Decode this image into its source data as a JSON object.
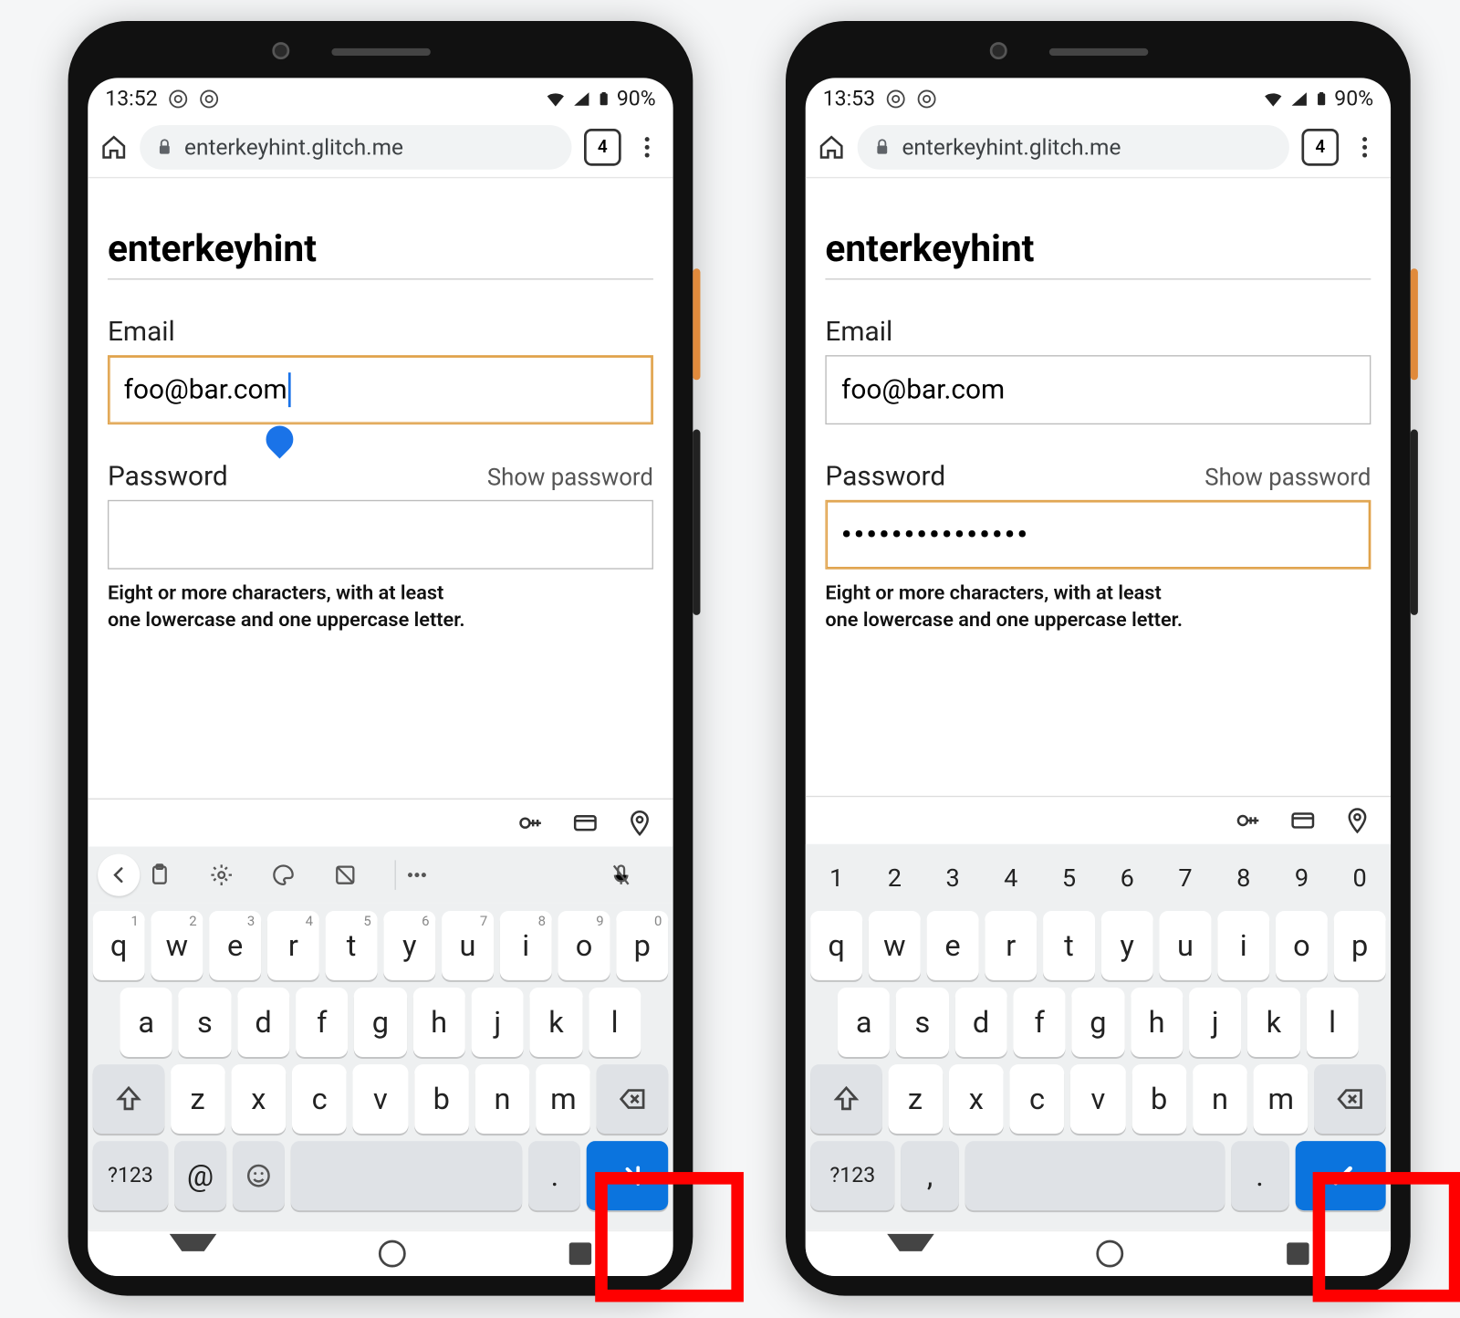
{
  "phones": [
    {
      "status": {
        "time": "13:52",
        "battery": "90%"
      },
      "url": "enterkeyhint.glitch.me",
      "tab_count": "4",
      "page_title": "enterkeyhint",
      "email": {
        "label": "Email",
        "value": "foo@bar.com",
        "focused": true
      },
      "password": {
        "label": "Password",
        "show_label": "Show password",
        "value": "",
        "focused": false
      },
      "hint_line1": "Eight or more characters, with at least",
      "hint_line2": "one lowercase and one uppercase letter.",
      "keyboard": {
        "has_number_row": false,
        "has_toolbar": true,
        "row1": [
          {
            "k": "q",
            "s": "1"
          },
          {
            "k": "w",
            "s": "2"
          },
          {
            "k": "e",
            "s": "3"
          },
          {
            "k": "r",
            "s": "4"
          },
          {
            "k": "t",
            "s": "5"
          },
          {
            "k": "y",
            "s": "6"
          },
          {
            "k": "u",
            "s": "7"
          },
          {
            "k": "i",
            "s": "8"
          },
          {
            "k": "o",
            "s": "9"
          },
          {
            "k": "p",
            "s": "0"
          }
        ],
        "row2": [
          "a",
          "s",
          "d",
          "f",
          "g",
          "h",
          "j",
          "k",
          "l"
        ],
        "row3": [
          "z",
          "x",
          "c",
          "v",
          "b",
          "n",
          "m"
        ],
        "bottom": {
          "sym": "?123",
          "extra": "@",
          "emoji": "☺",
          "dot": ".",
          "enter_type": "next"
        }
      }
    },
    {
      "status": {
        "time": "13:53",
        "battery": "90%"
      },
      "url": "enterkeyhint.glitch.me",
      "tab_count": "4",
      "page_title": "enterkeyhint",
      "email": {
        "label": "Email",
        "value": "foo@bar.com",
        "focused": false
      },
      "password": {
        "label": "Password",
        "show_label": "Show password",
        "value": "•••••••••••••••",
        "focused": true
      },
      "hint_line1": "Eight or more characters, with at least",
      "hint_line2": "one lowercase and one uppercase letter.",
      "keyboard": {
        "has_number_row": true,
        "has_toolbar": false,
        "num_row": [
          "1",
          "2",
          "3",
          "4",
          "5",
          "6",
          "7",
          "8",
          "9",
          "0"
        ],
        "row1": [
          {
            "k": "q"
          },
          {
            "k": "w"
          },
          {
            "k": "e"
          },
          {
            "k": "r"
          },
          {
            "k": "t"
          },
          {
            "k": "y"
          },
          {
            "k": "u"
          },
          {
            "k": "i"
          },
          {
            "k": "o"
          },
          {
            "k": "p"
          }
        ],
        "row2": [
          "a",
          "s",
          "d",
          "f",
          "g",
          "h",
          "j",
          "k",
          "l"
        ],
        "row3": [
          "z",
          "x",
          "c",
          "v",
          "b",
          "n",
          "m"
        ],
        "bottom": {
          "sym": "?123",
          "extra": ",",
          "emoji": "",
          "dot": ".",
          "enter_type": "done"
        }
      }
    }
  ]
}
